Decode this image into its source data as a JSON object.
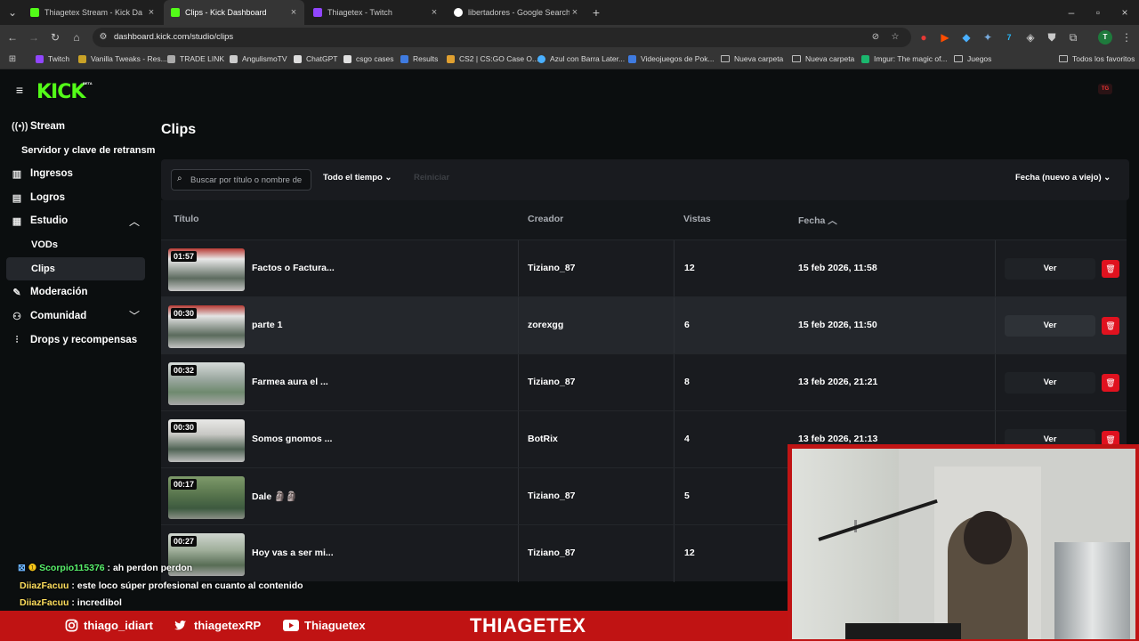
{
  "browser": {
    "tabs": [
      {
        "title": "Thiagetex Stream - Kick Da",
        "favicon_color": "#53fc18"
      },
      {
        "title": "Clips - Kick Dashboard",
        "favicon_color": "#53fc18",
        "active": true
      },
      {
        "title": "Thiagetex - Twitch",
        "favicon_color": "#9146ff"
      },
      {
        "title": "libertadores - Google Search",
        "favicon_color": "#ffffff"
      }
    ],
    "url": "dashboard.kick.com/studio/clips",
    "bookmarks": [
      "Twitch",
      "Vanilla Tweaks - Res...",
      "TRADE LINK",
      "AngulismoTV",
      "ChatGPT",
      "csgo cases",
      "Results",
      "CS2 | CS:GO Case O...",
      "Azul con Barra Later...",
      "Videojuegos de Pok...",
      "Nueva carpeta",
      "Nueva carpeta",
      "Imgur: The magic of...",
      "Juegos"
    ],
    "all_bookmarks": "Todos los favoritos"
  },
  "app": {
    "logo": "KICK",
    "beta": "BETA",
    "avatar_initial": "TG",
    "sidebar": {
      "stream": "Stream",
      "stream_key": "Servidor y clave de retransm",
      "ingresos": "Ingresos",
      "logros": "Logros",
      "estudio": "Estudio",
      "vods": "VODs",
      "clips": "Clips",
      "moderacion": "Moderación",
      "comunidad": "Comunidad",
      "drops": "Drops y recompensas"
    },
    "page_title": "Clips",
    "filters": {
      "search_placeholder": "Buscar por título o nombre de",
      "time": "Todo el tiempo",
      "reset": "Reiniciar",
      "sort": "Fecha (nuevo a viejo)"
    },
    "columns": {
      "title": "Título",
      "creator": "Creador",
      "views": "Vistas",
      "date": "Fecha"
    },
    "view_label": "Ver",
    "clips": [
      {
        "duration": "01:57",
        "title": "Factos o Factura...",
        "creator": "Tiziano_87",
        "views": "12",
        "date": "15 feb 2026, 11:58"
      },
      {
        "duration": "00:30",
        "title": "parte 1",
        "creator": "zorexgg",
        "views": "6",
        "date": "15 feb 2026, 11:50"
      },
      {
        "duration": "00:32",
        "title": "Farmea aura el ...",
        "creator": "Tiziano_87",
        "views": "8",
        "date": "13 feb 2026, 21:21"
      },
      {
        "duration": "00:30",
        "title": "Somos gnomos ...",
        "creator": "BotRix",
        "views": "4",
        "date": "13 feb 2026, 21:13"
      },
      {
        "duration": "00:17",
        "title": "Dale 🗿🗿",
        "creator": "Tiziano_87",
        "views": "5",
        "date": ""
      },
      {
        "duration": "00:27",
        "title": "Hoy vas a ser mi...",
        "creator": "Tiziano_87",
        "views": "12",
        "date": ""
      }
    ]
  },
  "stream_overlay": {
    "chat": [
      {
        "user": "Scorpio115376",
        "message": "ah perdon perdon"
      },
      {
        "user": "DiiazFacuu",
        "message": "este loco súper profesional en cuanto al contenido"
      },
      {
        "user": "DiiazFacuu",
        "message": "incredibol"
      }
    ],
    "instagram": "thiago_idiart",
    "twitter": "thiagetexRP",
    "youtube": "Thiaguetex",
    "brand": "THIAGETEX"
  }
}
